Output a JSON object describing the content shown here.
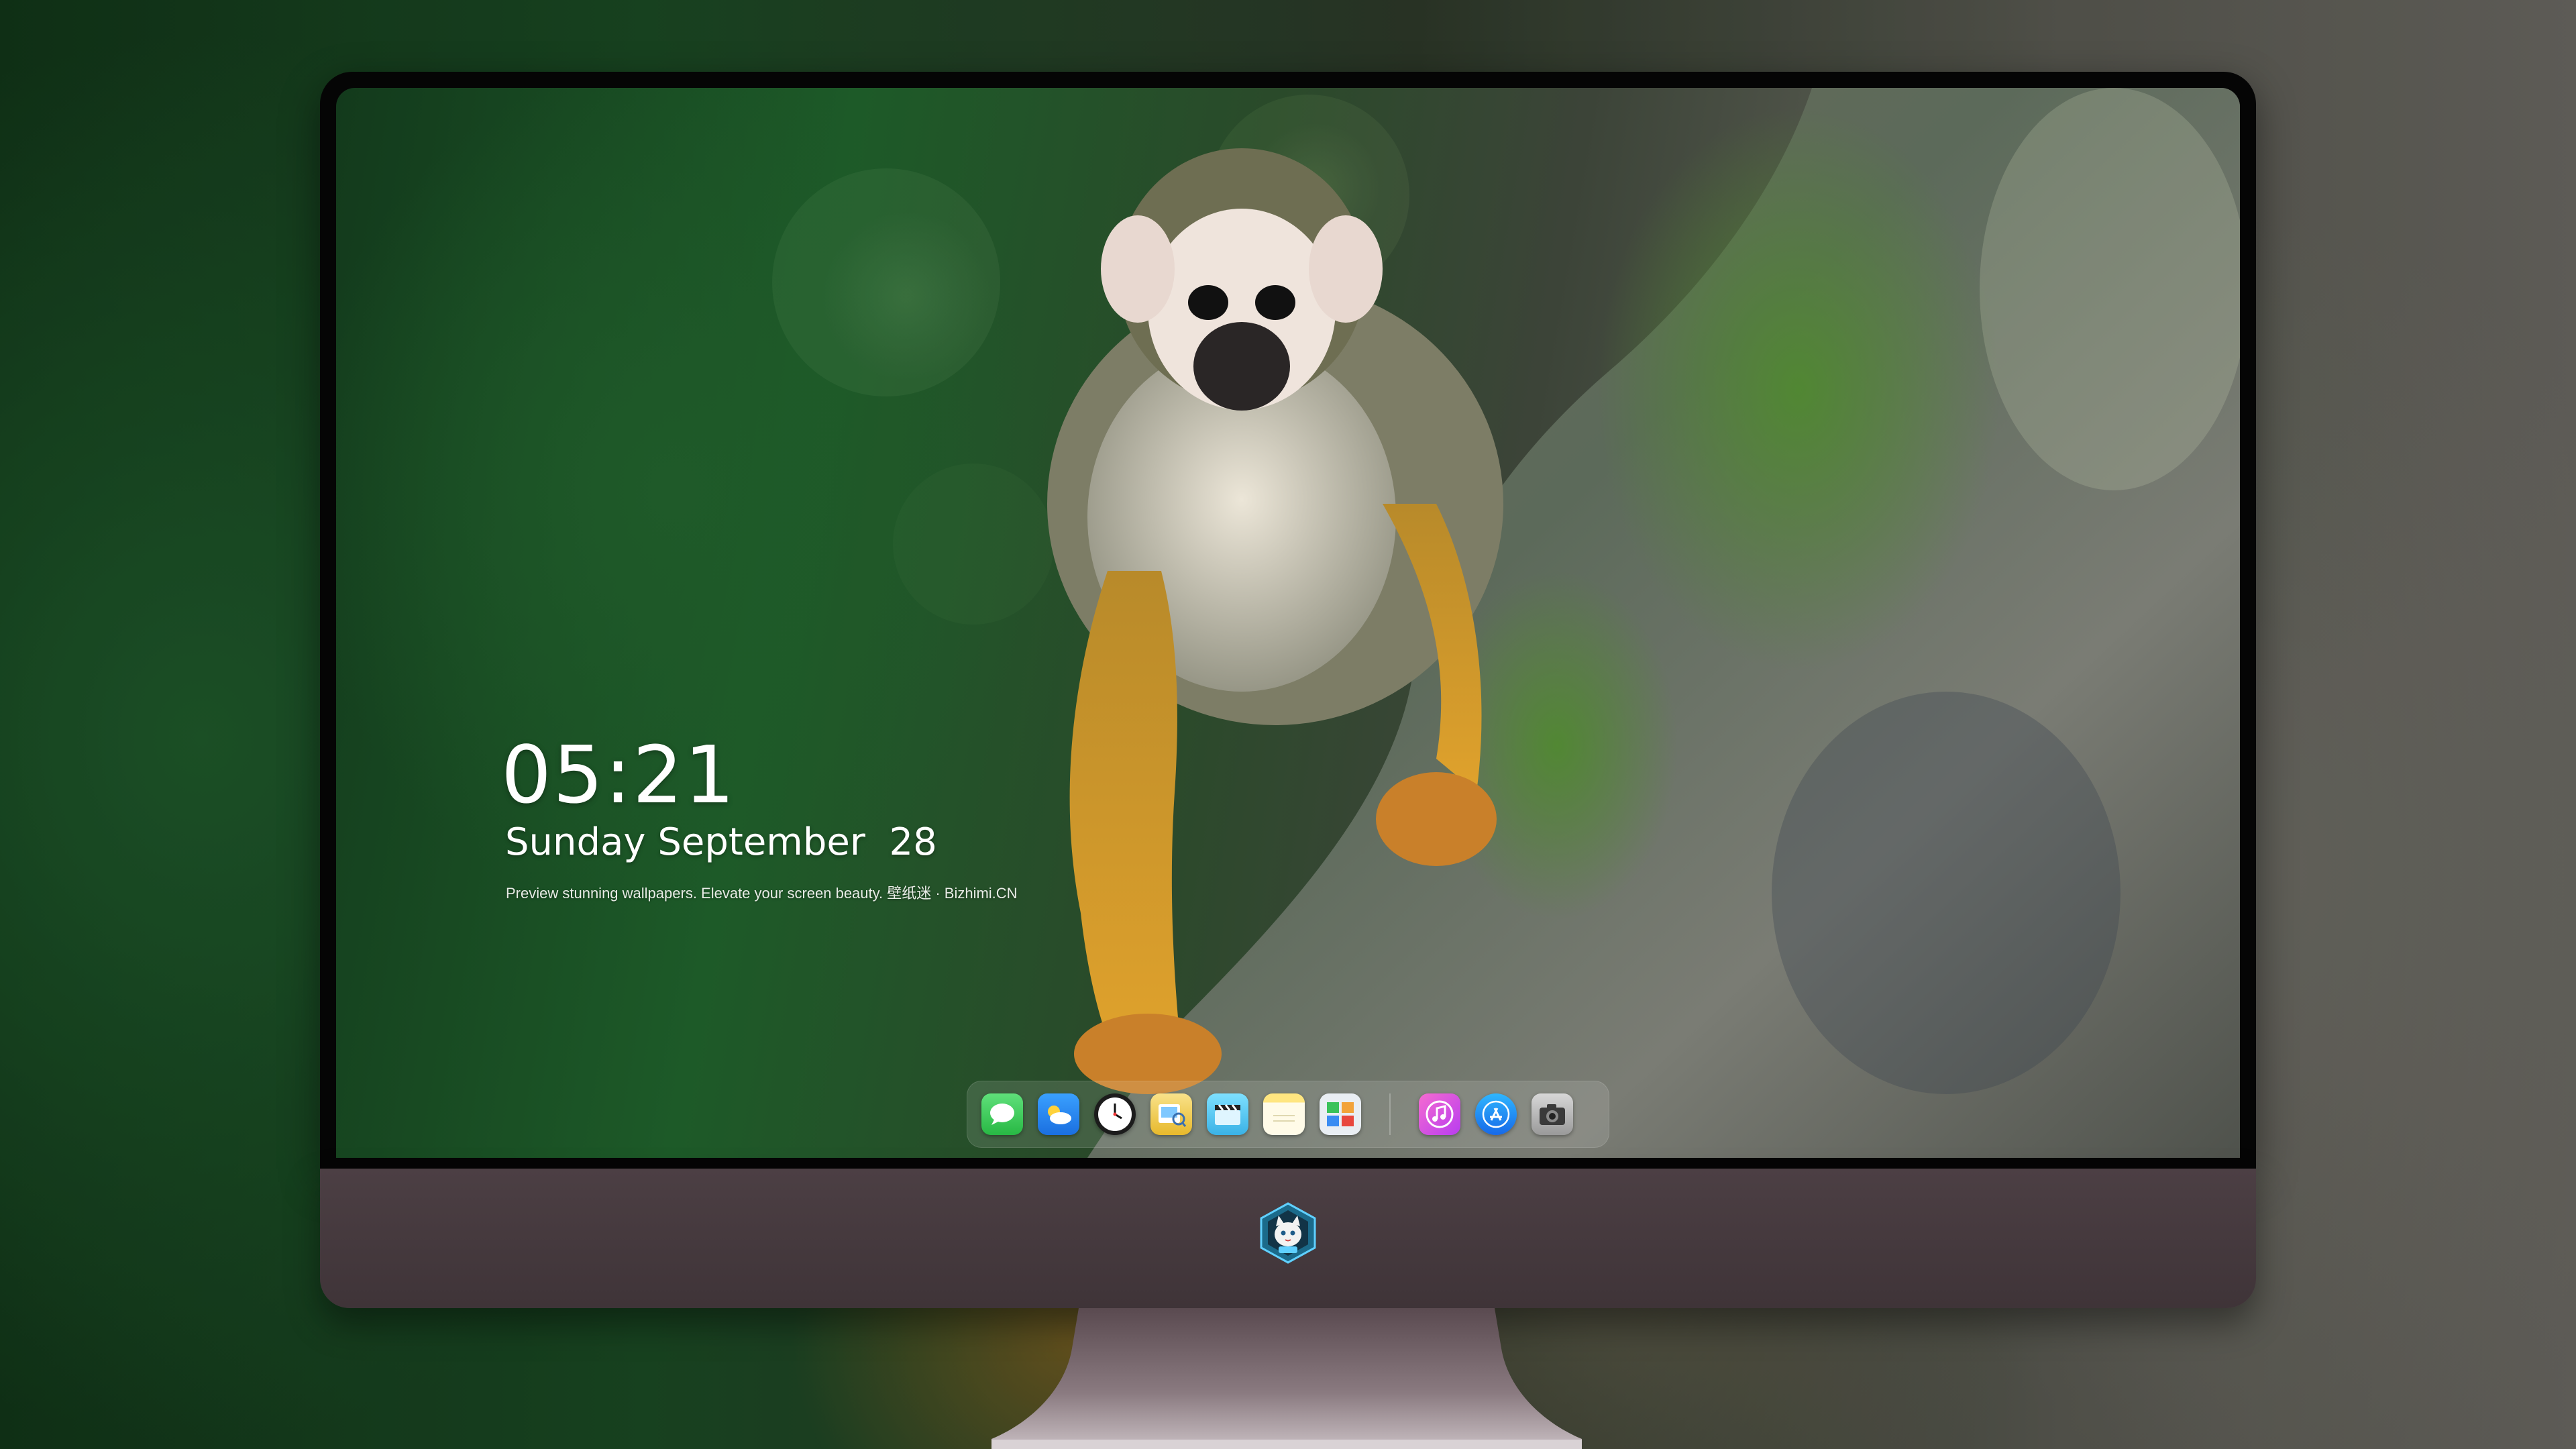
{
  "lock_screen": {
    "time": "05:21",
    "date": "Sunday September  28",
    "tagline": "Preview stunning wallpapers. Elevate your screen beauty. 壁纸迷 · Bizhimi.CN"
  },
  "dock": {
    "apps": [
      {
        "name": "messages-icon",
        "color": "#34c759"
      },
      {
        "name": "weather-icon",
        "color": "#2f8cff"
      },
      {
        "name": "clock-icon",
        "color": "#ffffff"
      },
      {
        "name": "preview-icon",
        "color": "#f2c94c"
      },
      {
        "name": "clips-icon",
        "color": "#5ac8fa"
      },
      {
        "name": "notes-icon",
        "color": "#ffd60a"
      },
      {
        "name": "photo-booth-icon",
        "color": "#e9eef3"
      },
      {
        "name": "itunes-icon",
        "color": "#e040fb"
      },
      {
        "name": "app-store-icon",
        "color": "#1e90ff"
      },
      {
        "name": "camera-icon",
        "color": "#bdbdbd"
      }
    ]
  },
  "colors": {
    "bezel": "#050505",
    "chin": "#4c3f44",
    "text": "#ffffff"
  }
}
